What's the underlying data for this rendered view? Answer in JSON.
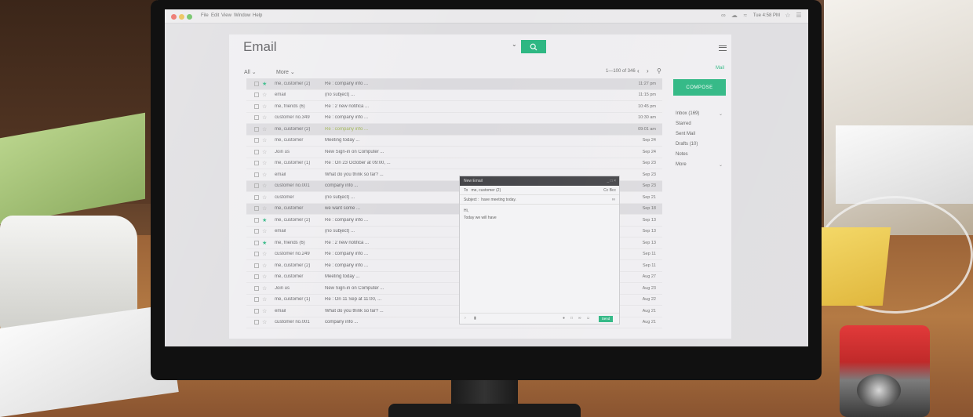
{
  "menubar": {
    "items": [
      "File",
      "Edit",
      "View",
      "Window",
      "Help"
    ],
    "clock": "Tue 4:58 PM"
  },
  "app": {
    "title": "Email",
    "search_placeholder": "",
    "accent": "#1fb27a"
  },
  "toolbar": {
    "all_label": "All",
    "more_label": "More",
    "pager": "1—100 of 346"
  },
  "sidebar": {
    "mail_label": "Mail",
    "compose_label": "COMPOSE",
    "folders": [
      {
        "label": "Inbox",
        "count": "(169)"
      },
      {
        "label": "Starred",
        "count": ""
      },
      {
        "label": "Sent Mail",
        "count": ""
      },
      {
        "label": "Drafts",
        "count": "(10)"
      },
      {
        "label": "Notes",
        "count": ""
      },
      {
        "label": "More",
        "count": ""
      }
    ]
  },
  "emails": [
    {
      "sender": "me, customer (2)",
      "subject": "Re : company info ...",
      "time": "11:27 pm",
      "starred": true,
      "highlight": true
    },
    {
      "sender": "email",
      "subject": "(no subject) ...",
      "time": "11:15 pm",
      "starred": false,
      "highlight": false
    },
    {
      "sender": "me, friends (6)",
      "subject": "Re : 2 new notifica ...",
      "time": "10:45 pm",
      "starred": false,
      "highlight": false
    },
    {
      "sender": "customer no.349",
      "subject": "Re : company info ...",
      "time": "10:30 am",
      "starred": false,
      "highlight": false
    },
    {
      "sender": "me, customer (2)",
      "subject": "Re : company info ...",
      "time": "09:01 am",
      "starred": false,
      "highlight": true,
      "green": true
    },
    {
      "sender": "me, customer",
      "subject": "Meeting today ...",
      "time": "Sep 24",
      "starred": false,
      "highlight": false
    },
    {
      "sender": "Join us",
      "subject": "New Sign-in on Computer ...",
      "time": "Sep 24",
      "starred": false,
      "highlight": false
    },
    {
      "sender": "me, customer (1)",
      "subject": "Re : On 23 October at 09:00, ...",
      "time": "Sep 23",
      "starred": false,
      "highlight": false
    },
    {
      "sender": "email",
      "subject": "What do you think so far? ...",
      "time": "Sep 23",
      "starred": false,
      "highlight": false
    },
    {
      "sender": "customer no.001",
      "subject": "company info ...",
      "time": "Sep 23",
      "starred": false,
      "highlight": true
    },
    {
      "sender": "customer",
      "subject": "(no subject) ...",
      "time": "Sep 21",
      "starred": false,
      "highlight": false
    },
    {
      "sender": "me, customer",
      "subject": "we want some ...",
      "time": "Sep 18",
      "starred": false,
      "highlight": true
    },
    {
      "sender": "me, customer (2)",
      "subject": "Re : company info ...",
      "time": "Sep 13",
      "starred": true,
      "highlight": false
    },
    {
      "sender": "email",
      "subject": "(no subject) ...",
      "time": "Sep 13",
      "starred": false,
      "highlight": false
    },
    {
      "sender": "me, friends (6)",
      "subject": "Re : 2 new notifica ...",
      "time": "Sep 13",
      "starred": true,
      "highlight": false
    },
    {
      "sender": "customer no.249",
      "subject": "Re : company info ...",
      "time": "Sep 11",
      "starred": false,
      "highlight": false
    },
    {
      "sender": "me, customer (2)",
      "subject": "Re : company info ...",
      "time": "Sep 11",
      "starred": false,
      "highlight": false
    },
    {
      "sender": "me, customer",
      "subject": "Meeting today ...",
      "time": "Aug 27",
      "starred": false,
      "highlight": false
    },
    {
      "sender": "Join us",
      "subject": "New Sign-in on Computer ...",
      "time": "Aug 23",
      "starred": false,
      "highlight": false
    },
    {
      "sender": "me, customer (1)",
      "subject": "Re : On 11 Sep at 11:00, ...",
      "time": "Aug 22",
      "starred": false,
      "highlight": false
    },
    {
      "sender": "email",
      "subject": "What do you think so far? ...",
      "time": "Aug 21",
      "starred": false,
      "highlight": false
    },
    {
      "sender": "customer no.001",
      "subject": "company info ...",
      "time": "Aug 21",
      "starred": false,
      "highlight": false
    }
  ],
  "compose": {
    "window_title": "New Email",
    "to_label": "To",
    "to_value": "me, customer (2)",
    "cc_bcc": "Cc  Bcc",
    "subject_label": "Subject :",
    "subject_value": "have meeting today.",
    "body_line1": "Hi,",
    "body_line2": "Today we will have",
    "send_label": "Send"
  }
}
